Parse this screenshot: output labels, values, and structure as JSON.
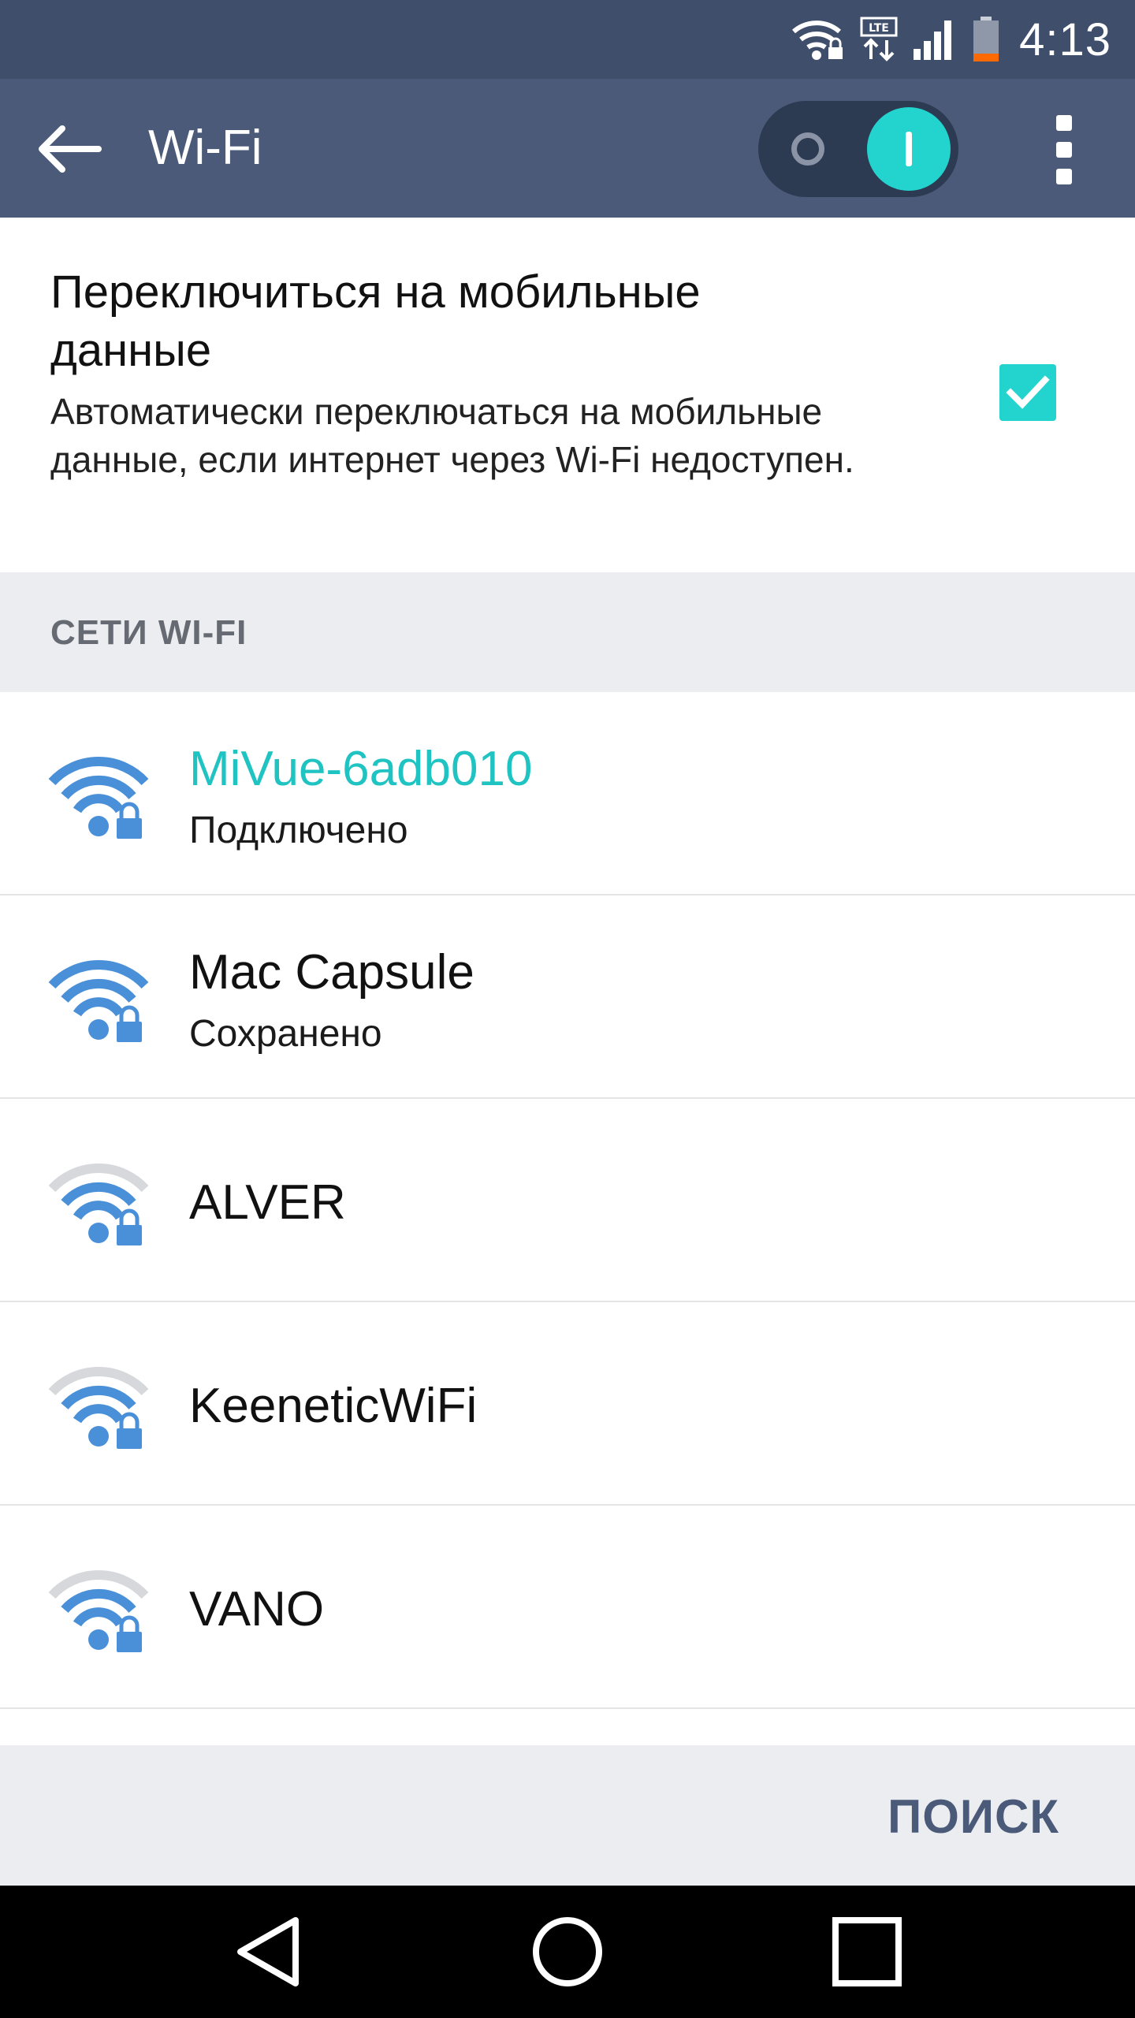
{
  "status_bar": {
    "time": "4:13",
    "icons": [
      "wifi-lock-icon",
      "lte-data-icon",
      "signal-icon",
      "battery-low-icon"
    ],
    "battery_color": "#ff6a00"
  },
  "app_bar": {
    "title": "Wi-Fi",
    "wifi_enabled": true,
    "accent": "#22d4cd"
  },
  "mobile_data": {
    "title": "Переключиться на мобильные данные",
    "description": "Автоматически переключаться на мобильные данные, если интернет через Wi-Fi недоступен.",
    "checked": true
  },
  "section": {
    "header": "СЕТИ WI-FI"
  },
  "networks": [
    {
      "name": "MiVue-6adb010",
      "status": "Подключено",
      "signal_bars": 4,
      "secured": true
    },
    {
      "name": "Mac Capsule",
      "status": "Сохранено",
      "signal_bars": 4,
      "secured": true
    },
    {
      "name": "ALVER",
      "status": "",
      "signal_bars": 3,
      "secured": true
    },
    {
      "name": "KeeneticWiFi",
      "status": "",
      "signal_bars": 3,
      "secured": true
    },
    {
      "name": "VANO",
      "status": "",
      "signal_bars": 3,
      "secured": true
    }
  ],
  "footer": {
    "search_label": "ПОИСК"
  },
  "nav_bar": {
    "icons": [
      "back-triangle-icon",
      "home-circle-icon",
      "recents-square-icon"
    ]
  }
}
